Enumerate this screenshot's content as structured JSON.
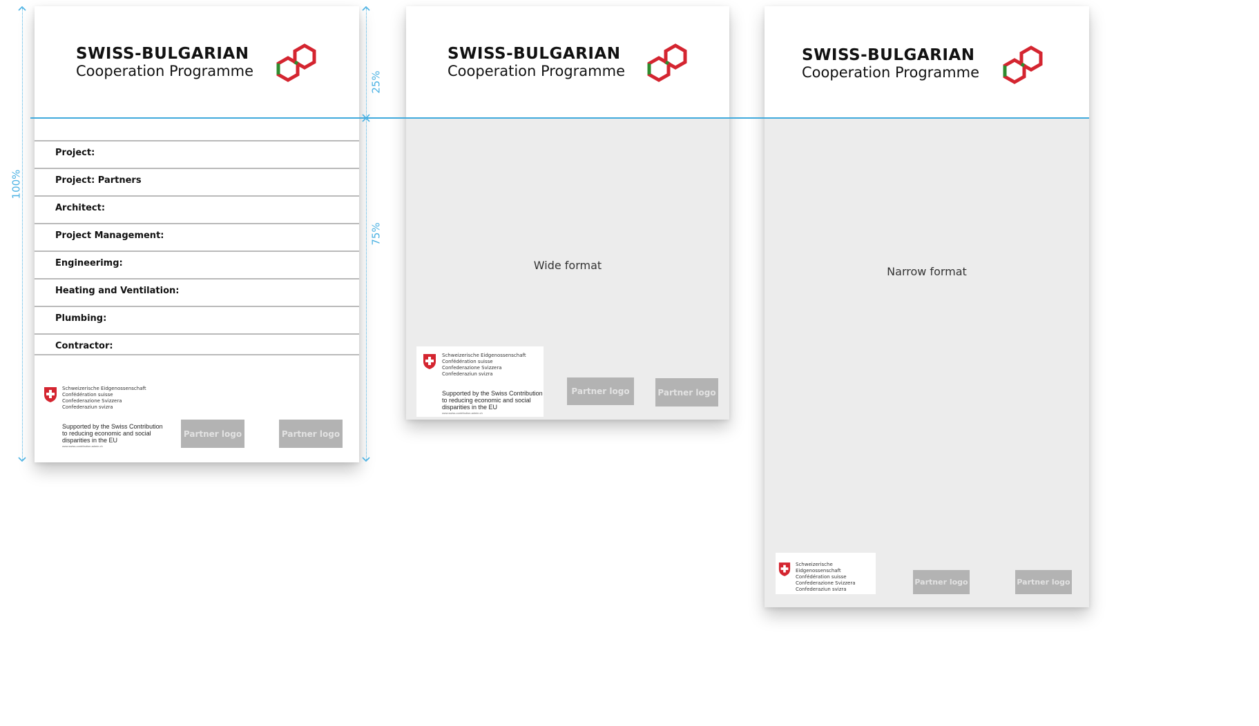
{
  "brand": {
    "title": "SWISS-BULGARIAN",
    "subtitle": "Cooperation Programme",
    "colors": {
      "red": "#d42530",
      "green": "#2e8b2e"
    }
  },
  "measurements": {
    "total_label": "100%",
    "top_label": "25%",
    "bottom_label": "75%",
    "guide_color": "#3fa9dc"
  },
  "detailed_panel": {
    "fields": [
      {
        "label": "Project:"
      },
      {
        "label": "Project:  Partners"
      },
      {
        "label": "Architect:"
      },
      {
        "label": "Project Management:"
      },
      {
        "label": "Engineerimg:"
      },
      {
        "label": "Heating and Ventilation:"
      },
      {
        "label": "Plumbing:"
      },
      {
        "label": "Contractor:"
      }
    ]
  },
  "swiss": {
    "names": [
      "Schweizerische Eidgenossenschaft",
      "Confédération suisse",
      "Confederazione Svizzera",
      "Confederaziun svizra"
    ],
    "support_lines": [
      "Supported by the Swiss Contribution",
      "to reducing economic and social",
      "disparities in the EU"
    ],
    "url": "www.swiss-contribution.admin.ch"
  },
  "partner_label": "Partner logo",
  "wide_panel": {
    "label": "Wide format"
  },
  "narrow_panel": {
    "label": "Narrow format"
  }
}
